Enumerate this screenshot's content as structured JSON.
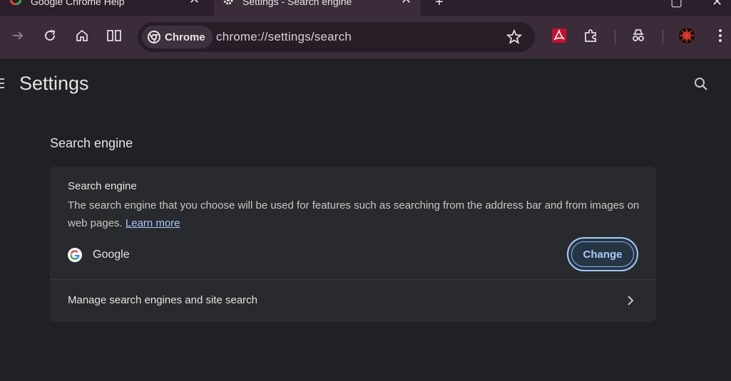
{
  "tabs": [
    {
      "title": "Google Chrome Help",
      "close": "✕"
    },
    {
      "title": "Settings - Search engine",
      "close": "✕"
    }
  ],
  "new_tab_label": "+",
  "window_controls": {
    "maximize": "▢",
    "close": "✕"
  },
  "toolbar": {
    "chip_label": "Chrome",
    "url": "chrome://settings/search"
  },
  "settings": {
    "title": "Settings",
    "section_title": "Search engine",
    "card": {
      "heading": "Search engine",
      "description": "The search engine that you choose will be used for features such as searching from the address bar and from images on web pages.",
      "learn_more": "Learn more",
      "current_engine": "Google",
      "change_button": "Change",
      "manage_label": "Manage search engines and site search"
    }
  },
  "colors": {
    "accent": "#a8c7fa",
    "toolbar_bg": "#3a2c39",
    "page_bg": "#202124",
    "card_bg": "#292a2d"
  },
  "icons": [
    "forward-icon",
    "reload-icon",
    "home-icon",
    "split-view-icon",
    "chrome-logo-icon",
    "bookmark-star-icon",
    "pdf-extension-icon",
    "extensions-puzzle-icon",
    "incognito-icon",
    "profile-avatar",
    "more-menu-icon",
    "menu-icon",
    "search-icon",
    "google-g-icon",
    "chevron-right-icon"
  ]
}
